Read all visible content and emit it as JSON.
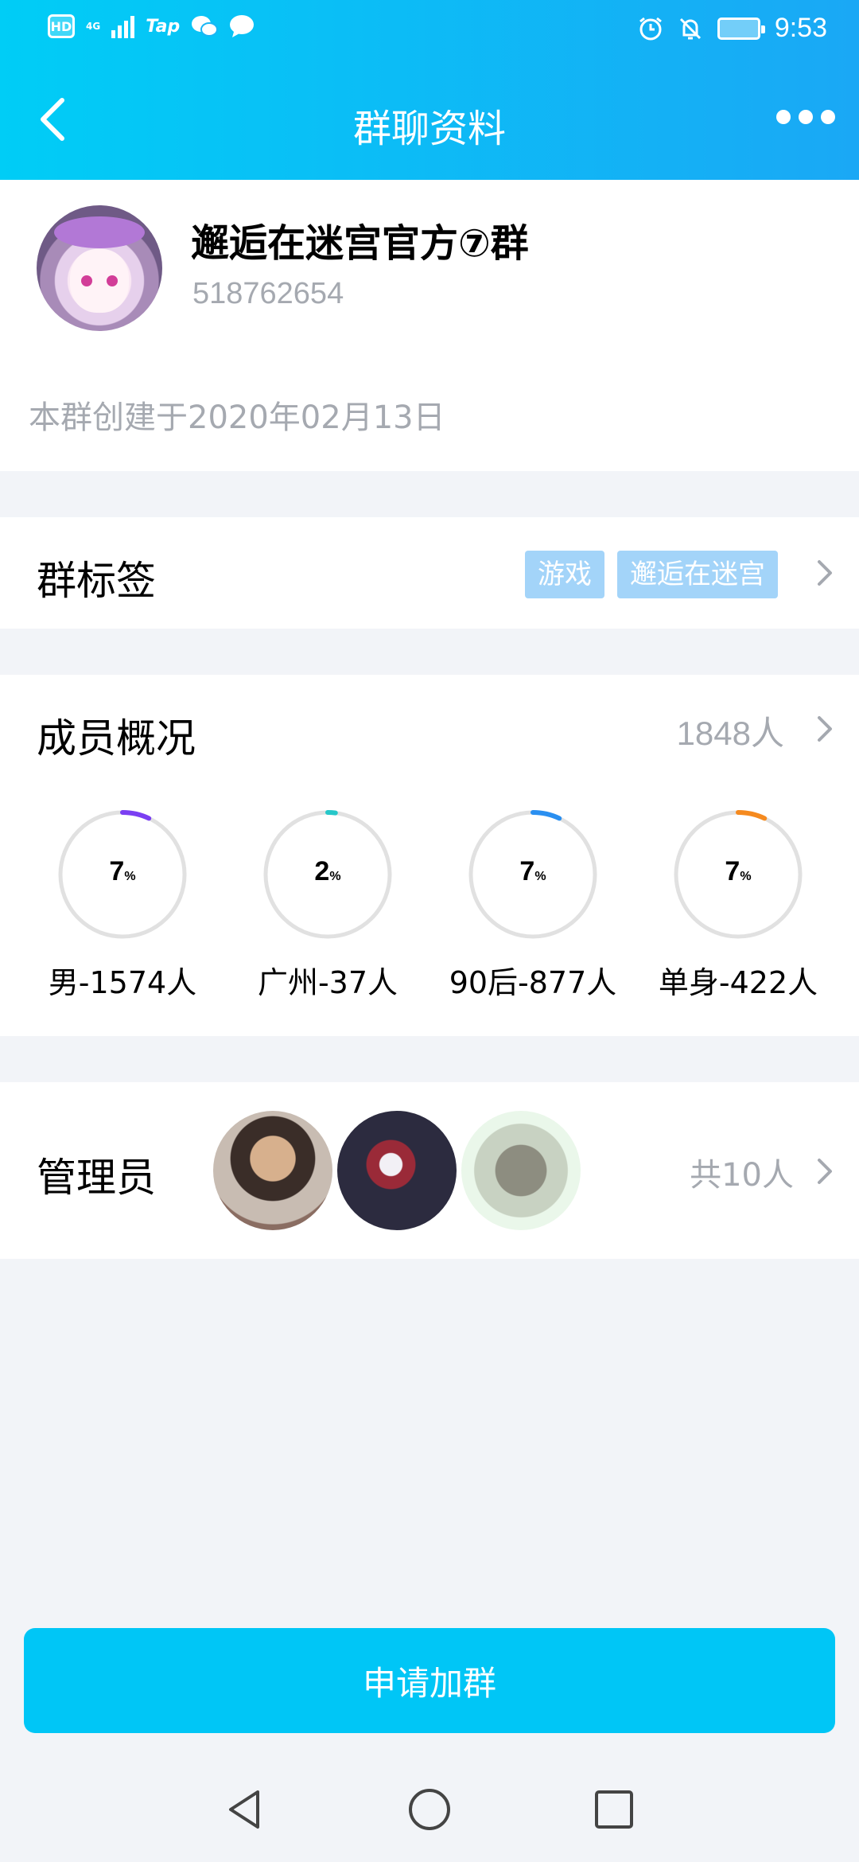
{
  "status_bar": {
    "hd": "HD",
    "network": "4G",
    "app_label": "Tap",
    "time": "9:53"
  },
  "nav": {
    "title": "群聊资料"
  },
  "group": {
    "name": "邂逅在迷宫官方⑦群",
    "id": "518762654",
    "created": "本群创建于2020年02月13日"
  },
  "tags": {
    "label": "群标签",
    "items": [
      "游戏",
      "邂逅在迷宫"
    ]
  },
  "members": {
    "label": "成员概况",
    "count": "1848人",
    "stats": [
      {
        "value": "7",
        "unit": "%",
        "label": "男-1574人",
        "color": "#7b3ff2",
        "fraction": 0.07
      },
      {
        "value": "2",
        "unit": "%",
        "label": "广州-37人",
        "color": "#26c7c9",
        "fraction": 0.02
      },
      {
        "value": "7",
        "unit": "%",
        "label": "90后-877人",
        "color": "#2a8ff0",
        "fraction": 0.07
      },
      {
        "value": "7",
        "unit": "%",
        "label": "单身-422人",
        "color": "#f58a1f",
        "fraction": 0.07
      }
    ]
  },
  "admins": {
    "label": "管理员",
    "count": "共10人"
  },
  "actions": {
    "join": "申请加群"
  },
  "colors": {
    "accent": "#00c6f6",
    "tag": "#a3d4f9",
    "secondary_text": "#a5a9b0"
  }
}
